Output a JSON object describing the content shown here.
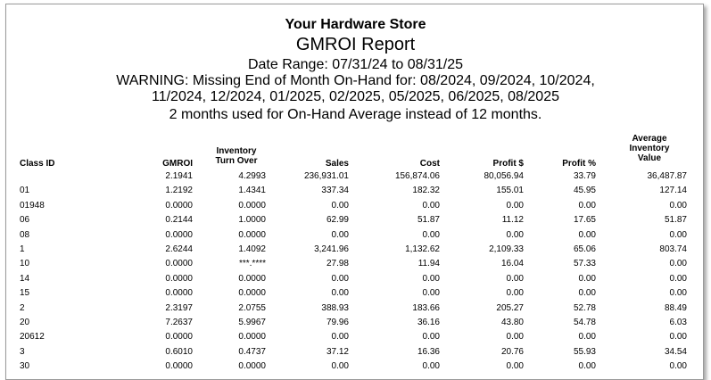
{
  "header": {
    "store_name": "Your Hardware Store",
    "report_title": "GMROI Report",
    "date_range": "Date Range: 07/31/24 to 08/31/25",
    "warning_line1": "WARNING:  Missing End of Month On-Hand for: 08/2024, 09/2024, 10/2024,",
    "warning_line2": "11/2024, 12/2024, 01/2025, 02/2025, 05/2025, 06/2025, 08/2025",
    "warning_line3": "2 months used for On-Hand Average instead of 12 months."
  },
  "columns": {
    "class_id": "Class ID",
    "gmroi": "GMROI",
    "turn_l1": "Inventory",
    "turn_l2": "Turn Over",
    "sales": "Sales",
    "cost": "Cost",
    "profit_amt": "Profit $",
    "profit_pct": "Profit %",
    "avg_l1": "Average",
    "avg_l2": "Inventory",
    "avg_l3": "Value"
  },
  "rows": [
    {
      "class_id": "",
      "gmroi": "2.1941",
      "turn": "4.2993",
      "sales": "236,931.01",
      "cost": "156,874.06",
      "profit_amt": "80,056.94",
      "profit_pct": "33.79",
      "avg_inv": "36,487.87"
    },
    {
      "class_id": "01",
      "gmroi": "1.2192",
      "turn": "1.4341",
      "sales": "337.34",
      "cost": "182.32",
      "profit_amt": "155.01",
      "profit_pct": "45.95",
      "avg_inv": "127.14"
    },
    {
      "class_id": "01948",
      "gmroi": "0.0000",
      "turn": "0.0000",
      "sales": "0.00",
      "cost": "0.00",
      "profit_amt": "0.00",
      "profit_pct": "0.00",
      "avg_inv": "0.00"
    },
    {
      "class_id": "06",
      "gmroi": "0.2144",
      "turn": "1.0000",
      "sales": "62.99",
      "cost": "51.87",
      "profit_amt": "11.12",
      "profit_pct": "17.65",
      "avg_inv": "51.87"
    },
    {
      "class_id": "08",
      "gmroi": "0.0000",
      "turn": "0.0000",
      "sales": "0.00",
      "cost": "0.00",
      "profit_amt": "0.00",
      "profit_pct": "0.00",
      "avg_inv": "0.00"
    },
    {
      "class_id": "1",
      "gmroi": "2.6244",
      "turn": "1.4092",
      "sales": "3,241.96",
      "cost": "1,132.62",
      "profit_amt": "2,109.33",
      "profit_pct": "65.06",
      "avg_inv": "803.74"
    },
    {
      "class_id": "10",
      "gmroi": "0.0000",
      "turn": "***.****",
      "sales": "27.98",
      "cost": "11.94",
      "profit_amt": "16.04",
      "profit_pct": "57.33",
      "avg_inv": "0.00"
    },
    {
      "class_id": "14",
      "gmroi": "0.0000",
      "turn": "0.0000",
      "sales": "0.00",
      "cost": "0.00",
      "profit_amt": "0.00",
      "profit_pct": "0.00",
      "avg_inv": "0.00"
    },
    {
      "class_id": "15",
      "gmroi": "0.0000",
      "turn": "0.0000",
      "sales": "0.00",
      "cost": "0.00",
      "profit_amt": "0.00",
      "profit_pct": "0.00",
      "avg_inv": "0.00"
    },
    {
      "class_id": "2",
      "gmroi": "2.3197",
      "turn": "2.0755",
      "sales": "388.93",
      "cost": "183.66",
      "profit_amt": "205.27",
      "profit_pct": "52.78",
      "avg_inv": "88.49"
    },
    {
      "class_id": "20",
      "gmroi": "7.2637",
      "turn": "5.9967",
      "sales": "79.96",
      "cost": "36.16",
      "profit_amt": "43.80",
      "profit_pct": "54.78",
      "avg_inv": "6.03"
    },
    {
      "class_id": "20612",
      "gmroi": "0.0000",
      "turn": "0.0000",
      "sales": "0.00",
      "cost": "0.00",
      "profit_amt": "0.00",
      "profit_pct": "0.00",
      "avg_inv": "0.00"
    },
    {
      "class_id": "3",
      "gmroi": "0.6010",
      "turn": "0.4737",
      "sales": "37.12",
      "cost": "16.36",
      "profit_amt": "20.76",
      "profit_pct": "55.93",
      "avg_inv": "34.54"
    },
    {
      "class_id": "30",
      "gmroi": "0.0000",
      "turn": "0.0000",
      "sales": "0.00",
      "cost": "0.00",
      "profit_amt": "0.00",
      "profit_pct": "0.00",
      "avg_inv": "0.00"
    }
  ]
}
